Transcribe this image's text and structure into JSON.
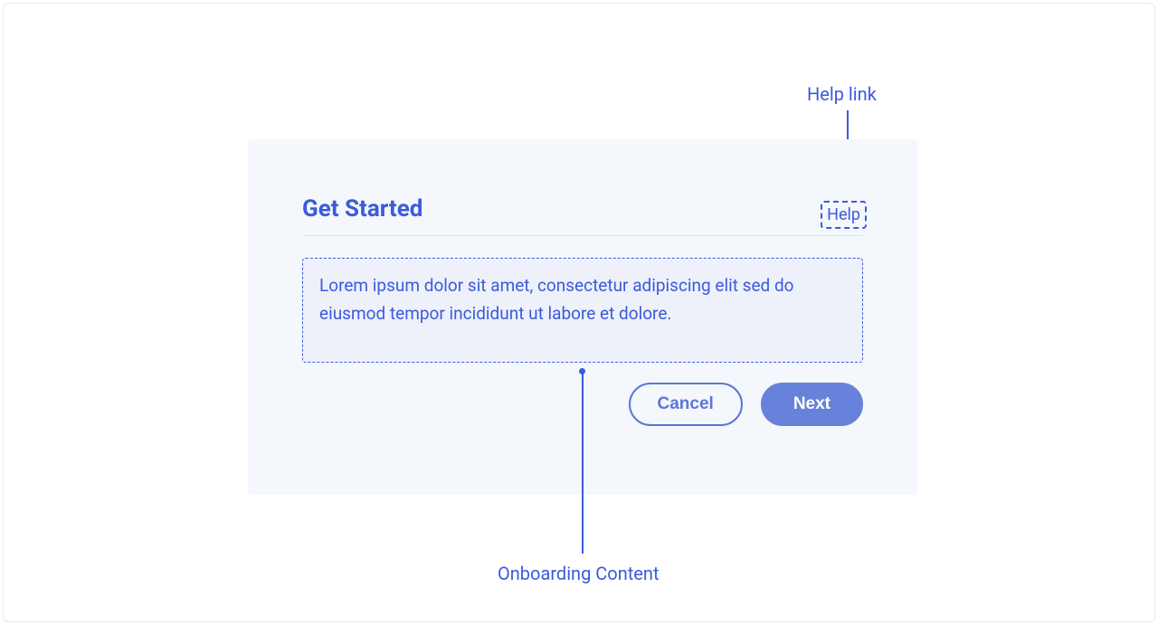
{
  "annotations": {
    "help_link": "Help link",
    "onboarding_content": "Onboarding Content"
  },
  "dialog": {
    "title": "Get Started",
    "help_label": "Help",
    "body": "Lorem ipsum dolor sit amet, consectetur adipiscing elit sed do eiusmod tempor incididunt ut labore et dolore.",
    "cancel_label": "Cancel",
    "next_label": "Next"
  }
}
